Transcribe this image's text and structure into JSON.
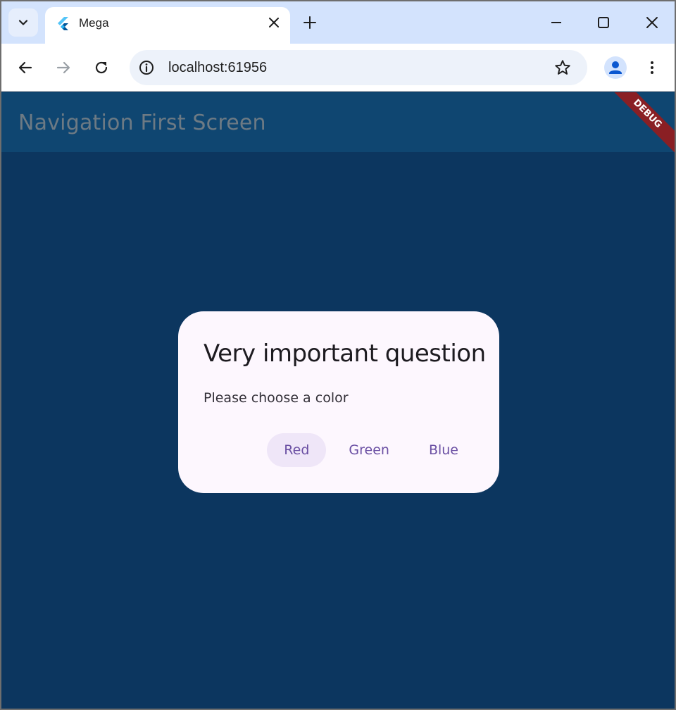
{
  "browser": {
    "tab": {
      "title": "Mega",
      "favicon": "flutter-logo-icon"
    },
    "url": "localhost:61956",
    "icons": {
      "tab_search": "chevron-down-icon",
      "tab_close": "close-icon",
      "new_tab": "plus-icon",
      "minimize": "minimize-icon",
      "maximize": "maximize-icon",
      "close": "close-icon",
      "back": "arrow-left-icon",
      "forward": "arrow-right-icon",
      "reload": "reload-icon",
      "site_info": "info-icon",
      "bookmark": "star-icon",
      "profile": "person-icon",
      "menu": "more-vert-icon"
    }
  },
  "app": {
    "appbar_title": "Navigation First Screen",
    "debug_banner": "DEBUG",
    "colors": {
      "background": "#0c365f",
      "appbar": "#0f4671",
      "dialog": "#fdf7fe",
      "accent": "#6a4fa3",
      "debug": "#8a1f24"
    }
  },
  "dialog": {
    "title": "Very important question",
    "content": "Please choose a color",
    "actions": [
      {
        "label": "Red"
      },
      {
        "label": "Green"
      },
      {
        "label": "Blue"
      }
    ]
  }
}
